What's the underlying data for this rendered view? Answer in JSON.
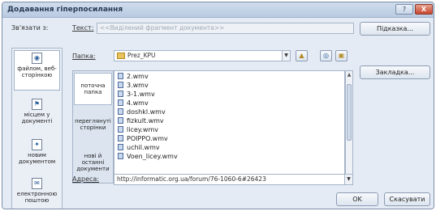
{
  "window": {
    "title": "Додавання гіперпосилання",
    "help_label": "?",
    "close_label": "X"
  },
  "link_to": {
    "label": "Зв'язати з:",
    "items": [
      {
        "label": "файлом, веб-сторінкою",
        "icon": "web-page-icon",
        "selected": true
      },
      {
        "label": "місцем у документі",
        "icon": "bookmark-place-icon"
      },
      {
        "label": "новим документом",
        "icon": "new-document-icon"
      },
      {
        "label": "електронною поштою",
        "icon": "email-icon"
      }
    ]
  },
  "text_field": {
    "label": "Текст:",
    "value": "<<Виділений фрагмент документа>>"
  },
  "screentip_button": "Підказка...",
  "folder": {
    "label": "Папка:",
    "value": "Prez_KPU"
  },
  "bookmark_button": "Закладка...",
  "nav": {
    "items": [
      {
        "label": "поточна папка",
        "selected": true
      },
      {
        "label": "переглянуті сторінки"
      },
      {
        "label": "нові й останні документи"
      }
    ]
  },
  "files": [
    "2.wmv",
    "3.wmv",
    "3-1.wmv",
    "4.wmv",
    "doshkl.wmv",
    "fizkult.wmv",
    "licey.wmv",
    "POIPPO.wmv",
    "uchil.wmv",
    "Voen_licey.wmv"
  ],
  "address": {
    "label": "Адреса:",
    "value": "http://informatic.org.ua/forum/76-1060-6#26423"
  },
  "ok_button": "OK",
  "cancel_button": "Скасувати"
}
